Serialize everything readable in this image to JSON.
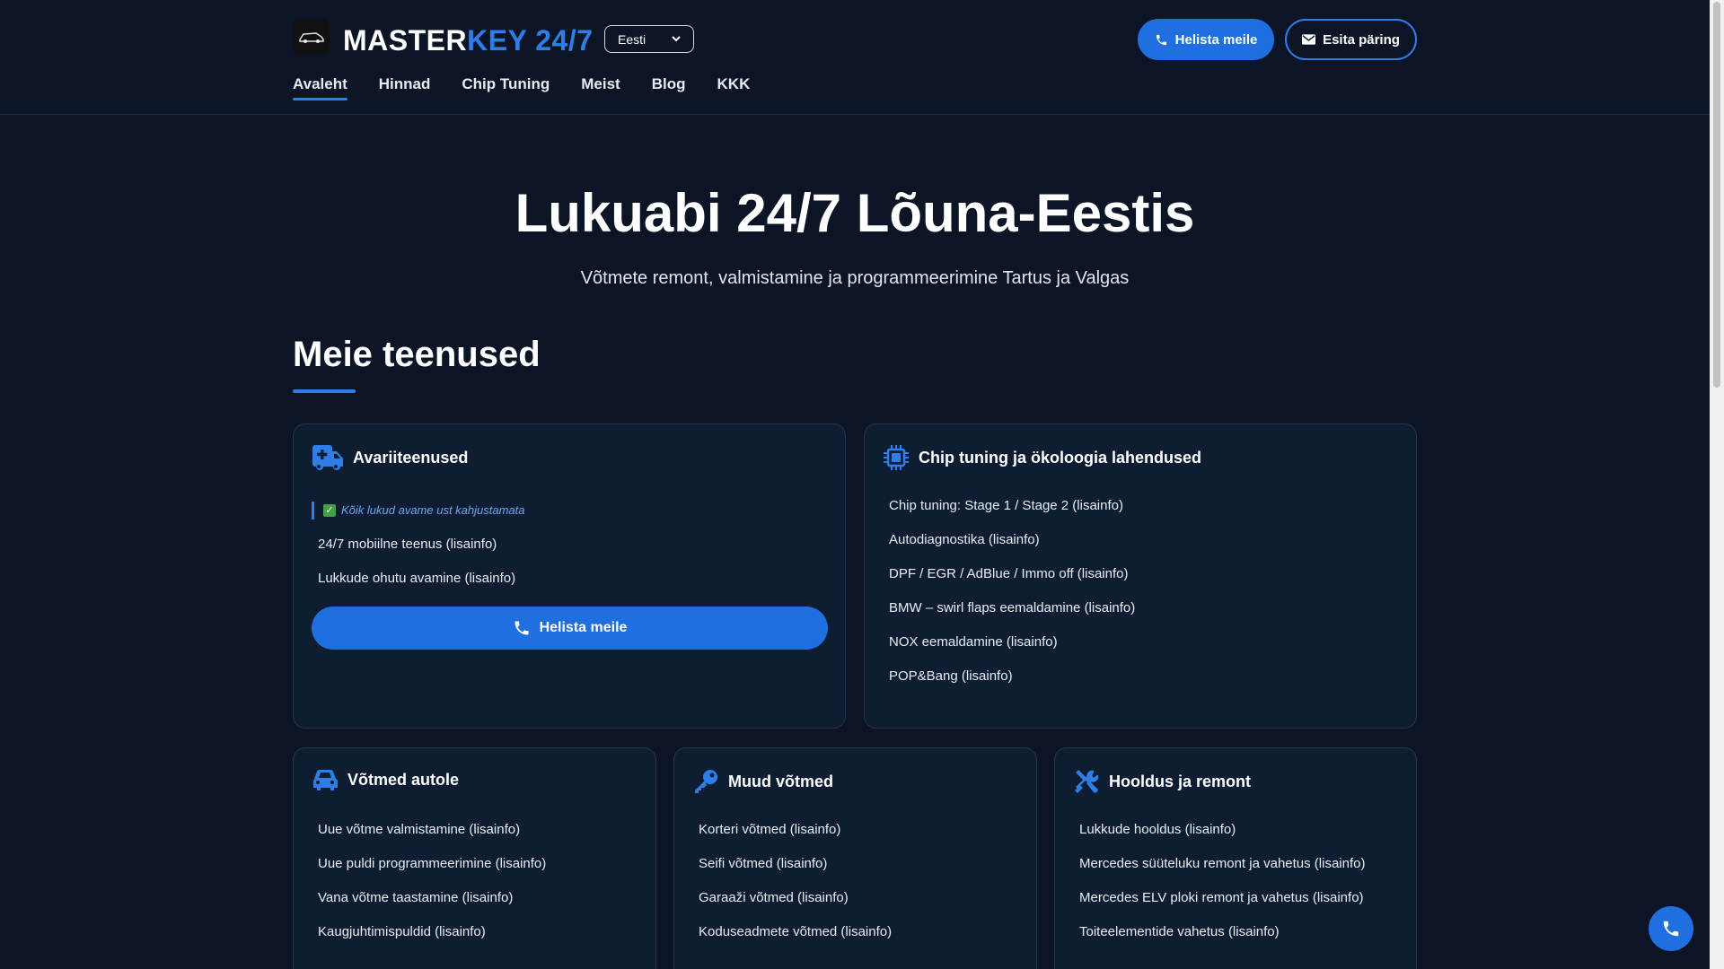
{
  "header": {
    "logo_part1": "MASTER",
    "logo_part2": "KEY 24/7",
    "language": "Eesti",
    "call_button": "Helista meile",
    "query_button": "Esita päring",
    "nav": [
      "Avaleht",
      "Hinnad",
      "Chip Tuning",
      "Meist",
      "Blog",
      "KKK"
    ],
    "active_nav": "Avaleht"
  },
  "hero": {
    "title": "Lukuabi 24/7 Lõuna-Eestis",
    "subtitle": "Võtmete remont, valmistamine ja programmeerimine Tartus ja Valgas"
  },
  "services": {
    "title": "Meie teenused",
    "emergency": {
      "title": "Avariiteenused",
      "note": "Kõik lukud avame ust kahjustamata",
      "items": [
        "24/7 mobiilne teenus (lisainfo)",
        "Lukkude ohutu avamine (lisainfo)"
      ],
      "button": "Helista meile"
    },
    "chip": {
      "title": "Chip tuning ja ökoloogia lahendused",
      "items": [
        "Chip tuning: Stage 1 / Stage 2 (lisainfo)",
        "Autodiagnostika (lisainfo)",
        "DPF / EGR / AdBlue / Immo off (lisainfo)",
        "BMW – swirl flaps eemaldamine (lisainfo)",
        "NOX eemaldamine (lisainfo)",
        "POP&Bang (lisainfo)"
      ]
    },
    "car_keys": {
      "title": "Võtmed autole",
      "items": [
        "Uue võtme valmistamine (lisainfo)",
        "Uue puldi programmeerimine (lisainfo)",
        "Vana võtme taastamine (lisainfo)",
        "Kaugjuhtimispuldid (lisainfo)"
      ]
    },
    "other_keys": {
      "title": "Muud võtmed",
      "items": [
        "Korteri võtmed (lisainfo)",
        "Seifi võtmed (lisainfo)",
        "Garaaži võtmed (lisainfo)",
        "Koduseadmete võtmed (lisainfo)"
      ]
    },
    "maintenance": {
      "title": "Hooldus ja remont",
      "items": [
        "Lukkude hooldus (lisainfo)",
        "Mercedes süüteluku remont ja vahetus (lisainfo)",
        "Mercedes ELV ploki remont ja vahetus (lisainfo)",
        "Toiteelementide vahetus (lisainfo)"
      ]
    }
  },
  "icons": {
    "logo": "car-logo-icon",
    "phone": "phone-icon",
    "envelope": "envelope-icon",
    "ambulance": "ambulance-icon",
    "chip": "microchip-icon",
    "car": "car-icon",
    "key": "key-icon",
    "tools": "tools-icon",
    "check": "check-icon",
    "chevron": "chevron-down-icon"
  },
  "colors": {
    "background": "#0b1526",
    "accent": "#2f7ee8",
    "button": "#1f6fe0",
    "card": "#0f1d33"
  }
}
